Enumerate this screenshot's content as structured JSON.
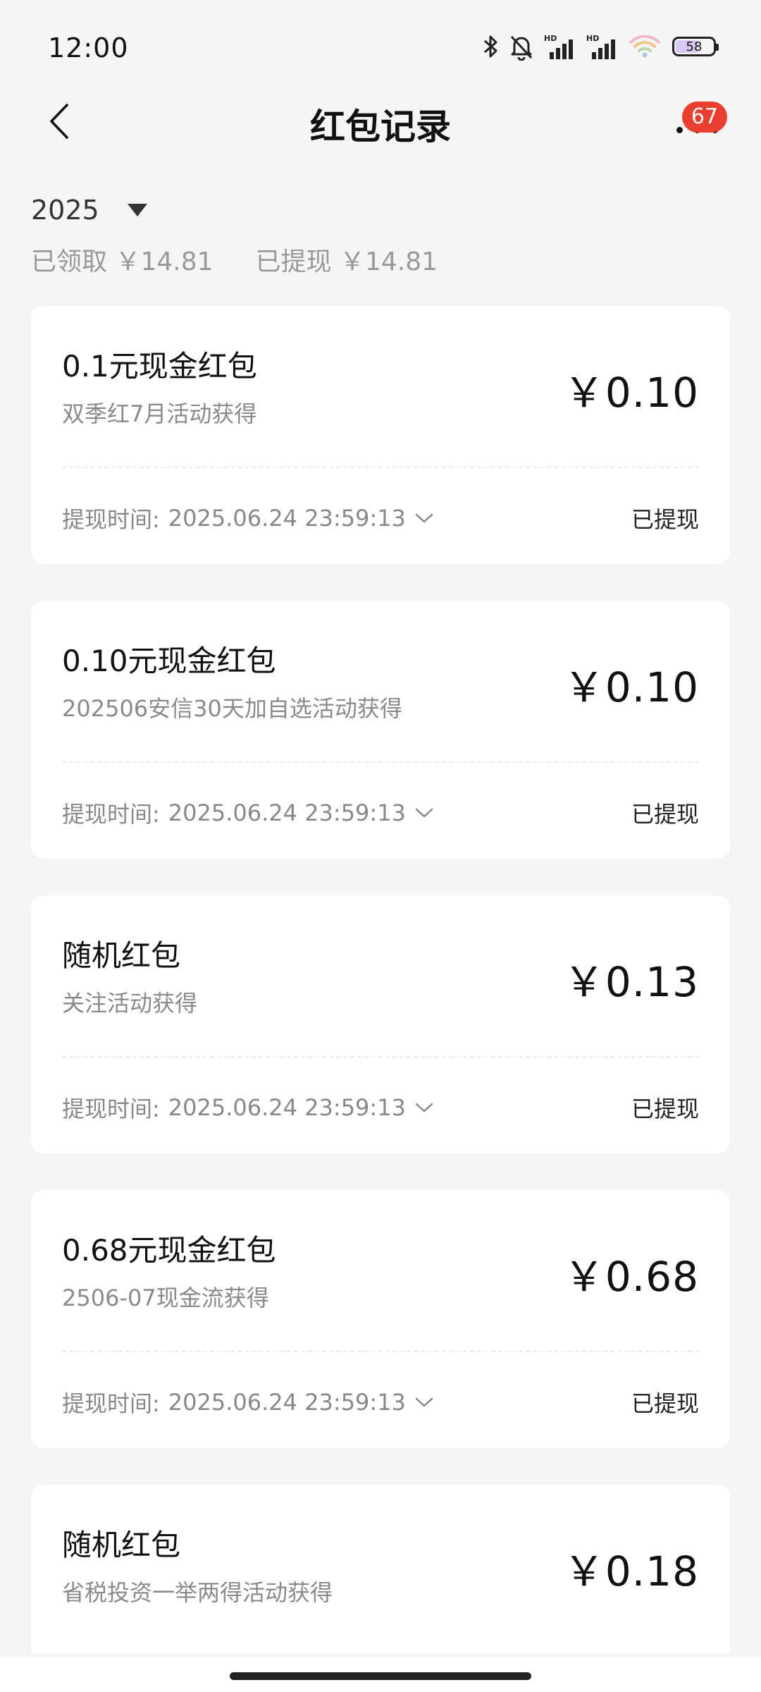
{
  "status_bar": {
    "time": "12:00",
    "battery_level": "58",
    "icons": [
      "bluetooth-icon",
      "bell-muted-icon",
      "hd-signal-icon",
      "hd-signal-icon",
      "wifi-icon",
      "battery-icon"
    ],
    "hd_label": "HD"
  },
  "nav": {
    "title": "红包记录",
    "badge_count": "67"
  },
  "summary": {
    "year": "2025",
    "received": "已领取 ￥14.81",
    "withdrawn": "已提现 ￥14.81"
  },
  "cards": [
    {
      "title": "0.1元现金红包",
      "source": "双季红7月活动获得",
      "amount": "￥0.10",
      "time_label": "提现时间:",
      "time_value": "2025.06.24 23:59:13",
      "status": "已提现"
    },
    {
      "title": "0.10元现金红包",
      "source": "202506安信30天加自选活动获得",
      "amount": "￥0.10",
      "time_label": "提现时间:",
      "time_value": "2025.06.24 23:59:13",
      "status": "已提现"
    },
    {
      "title": "随机红包",
      "source": "关注活动获得",
      "amount": "￥0.13",
      "time_label": "提现时间:",
      "time_value": "2025.06.24 23:59:13",
      "status": "已提现"
    },
    {
      "title": "0.68元现金红包",
      "source": "2506-07现金流获得",
      "amount": "￥0.68",
      "time_label": "提现时间:",
      "time_value": "2025.06.24 23:59:13",
      "status": "已提现"
    },
    {
      "title": "随机红包",
      "source": "省税投资一举两得活动获得",
      "amount": "￥0.18"
    }
  ]
}
